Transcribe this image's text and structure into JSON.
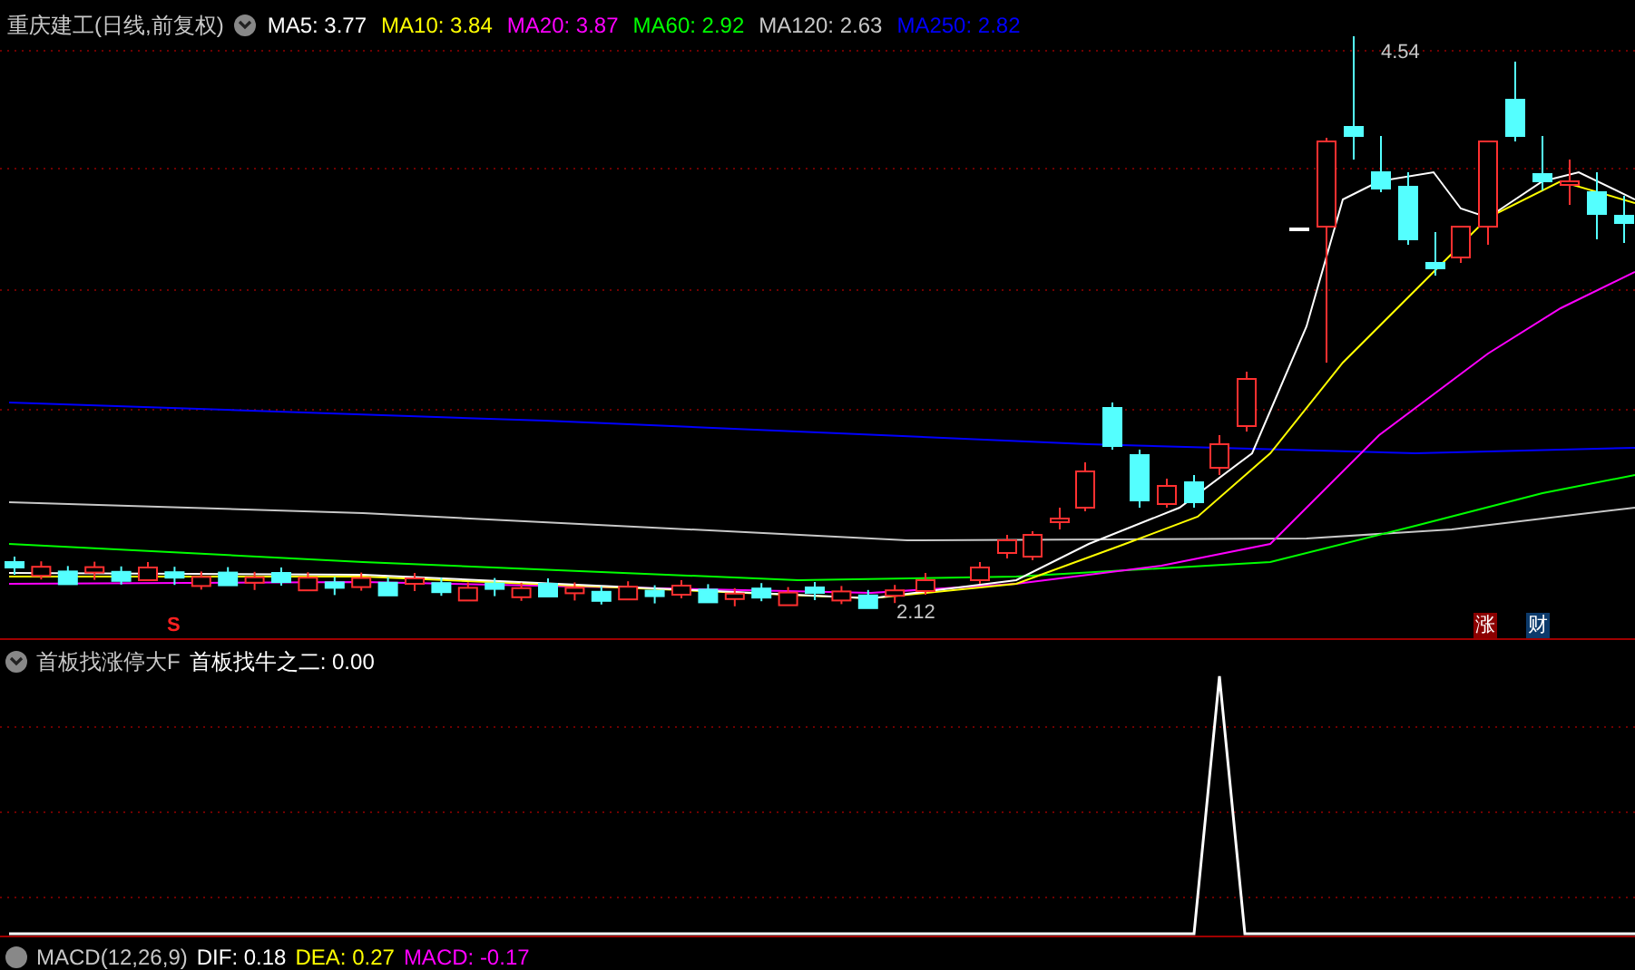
{
  "main_panel": {
    "title": "重庆建工(日线,前复权)",
    "indicators": [
      {
        "label": "MA5: 3.77",
        "color": "#ffffff"
      },
      {
        "label": "MA10: 3.84",
        "color": "#ffff00"
      },
      {
        "label": "MA20: 3.87",
        "color": "#ff00ff"
      },
      {
        "label": "MA60: 2.92",
        "color": "#00ff00"
      },
      {
        "label": "MA120: 2.63",
        "color": "#c8c8c8"
      },
      {
        "label": "MA250: 2.82",
        "color": "#0000ff"
      }
    ],
    "high_label": "4.54",
    "low_label": "2.12",
    "signal_mark": "S",
    "badges": [
      {
        "text": "涨",
        "color": "#8b0000"
      },
      {
        "text": "财",
        "color": "#0c3a6b"
      }
    ]
  },
  "sub_panel": {
    "formula": "首板找涨停大F",
    "reading": "首板找牛之二: 0.00"
  },
  "macd_panel": {
    "title": "MACD(12,26,9)",
    "readings": [
      {
        "label": "DIF: 0.18",
        "color": "#ffffff"
      },
      {
        "label": "DEA: 0.27",
        "color": "#ffff00"
      },
      {
        "label": "MACD: -0.17",
        "color": "#ff00ff"
      }
    ]
  }
}
